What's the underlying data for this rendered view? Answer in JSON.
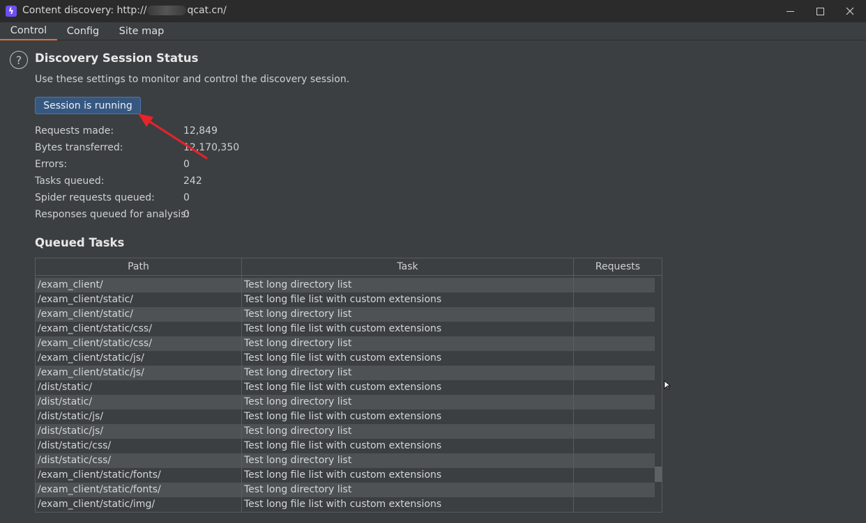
{
  "window": {
    "title_prefix": "Content discovery: http://",
    "title_suffix": "qcat.cn/",
    "icon_glyph": "ϟ",
    "help_glyph": "?"
  },
  "tabs": [
    {
      "label": "Control",
      "active": true
    },
    {
      "label": "Config",
      "active": false
    },
    {
      "label": "Site map",
      "active": false
    }
  ],
  "status": {
    "title": "Discovery Session Status",
    "description": "Use these settings to monitor and control the discovery session.",
    "button_label": "Session is running",
    "stats": [
      {
        "label": "Requests made:",
        "value": "12,849"
      },
      {
        "label": "Bytes transferred:",
        "value": "12,170,350"
      },
      {
        "label": "Errors:",
        "value": "0"
      },
      {
        "label": "Tasks queued:",
        "value": "242"
      },
      {
        "label": "Spider requests queued:",
        "value": "0"
      },
      {
        "label": "Responses queued for analysis:",
        "value": "0"
      }
    ]
  },
  "queued": {
    "title": "Queued Tasks",
    "columns": [
      "Path",
      "Task",
      "Requests"
    ],
    "rows": [
      {
        "path": "/exam_client/",
        "task": "Test long directory list",
        "requests": ""
      },
      {
        "path": "/exam_client/static/",
        "task": "Test long file list with custom extensions",
        "requests": ""
      },
      {
        "path": "/exam_client/static/",
        "task": "Test long directory list",
        "requests": ""
      },
      {
        "path": "/exam_client/static/css/",
        "task": "Test long file list with custom extensions",
        "requests": ""
      },
      {
        "path": "/exam_client/static/css/",
        "task": "Test long directory list",
        "requests": ""
      },
      {
        "path": "/exam_client/static/js/",
        "task": "Test long file list with custom extensions",
        "requests": ""
      },
      {
        "path": "/exam_client/static/js/",
        "task": "Test long directory list",
        "requests": ""
      },
      {
        "path": "/dist/static/",
        "task": "Test long file list with custom extensions",
        "requests": ""
      },
      {
        "path": "/dist/static/",
        "task": "Test long directory list",
        "requests": ""
      },
      {
        "path": "/dist/static/js/",
        "task": "Test long file list with custom extensions",
        "requests": ""
      },
      {
        "path": "/dist/static/js/",
        "task": "Test long directory list",
        "requests": ""
      },
      {
        "path": "/dist/static/css/",
        "task": "Test long file list with custom extensions",
        "requests": ""
      },
      {
        "path": "/dist/static/css/",
        "task": "Test long directory list",
        "requests": ""
      },
      {
        "path": "/exam_client/static/fonts/",
        "task": "Test long file list with custom extensions",
        "requests": ""
      },
      {
        "path": "/exam_client/static/fonts/",
        "task": "Test long directory list",
        "requests": ""
      },
      {
        "path": "/exam_client/static/img/",
        "task": "Test long file list with custom extensions",
        "requests": ""
      }
    ]
  },
  "colors": {
    "accent_tab": "#e0703a",
    "button_bg": "#365880",
    "annotation_arrow": "#e8232a"
  },
  "icons": {
    "app": "burp-lightning-icon",
    "help": "help-circle-icon",
    "minimize": "minimize-icon",
    "maximize": "maximize-icon",
    "close": "close-icon",
    "arrow": "annotation-arrow-icon",
    "cursor": "mouse-cursor-icon"
  }
}
